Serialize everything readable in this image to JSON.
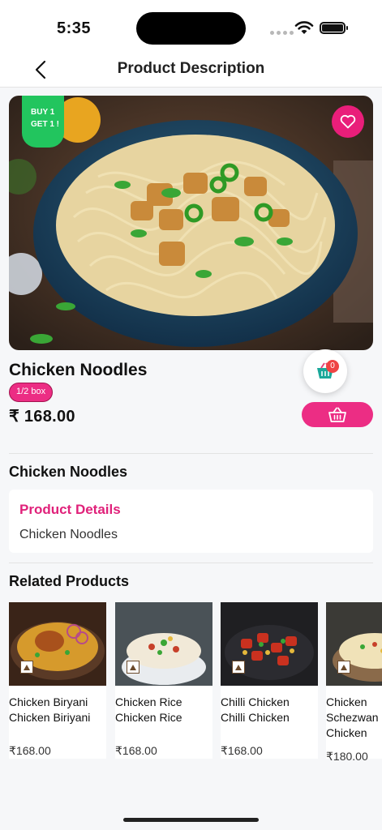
{
  "status_bar": {
    "time": "5:35"
  },
  "navbar": {
    "title": "Product Description"
  },
  "product": {
    "offer_line1": "BUY 1",
    "offer_line2": "GET 1 !",
    "name": "Chicken Noodles",
    "quantity": "1/2 box",
    "price": "₹ 168.00",
    "cart_count": "0"
  },
  "description_section": {
    "title": "Chicken Noodles",
    "details_heading": "Product Details",
    "details_text": "Chicken Noodles"
  },
  "related": {
    "title": "Related Products",
    "items": [
      {
        "line1": "Chicken Biryani",
        "line2": "Chicken Biriyani",
        "line3": "",
        "price": "₹168.00"
      },
      {
        "line1": "Chicken Rice",
        "line2": "Chicken Rice",
        "line3": "",
        "price": "₹168.00"
      },
      {
        "line1": "Chilli Chicken",
        "line2": "Chilli Chicken",
        "line3": "",
        "price": "₹168.00"
      },
      {
        "line1": "Chicken",
        "line2": "Schezwan",
        "line3": "Chicken",
        "price": "₹180.00"
      }
    ]
  },
  "colors": {
    "accent": "#e91e7a",
    "offer": "#22c55e",
    "badge_red": "#ef4444"
  },
  "icons": [
    "back-arrow-icon",
    "heart-icon",
    "cart-icon",
    "basket-icon",
    "veg-mark-icon",
    "wifi-icon",
    "battery-icon"
  ]
}
